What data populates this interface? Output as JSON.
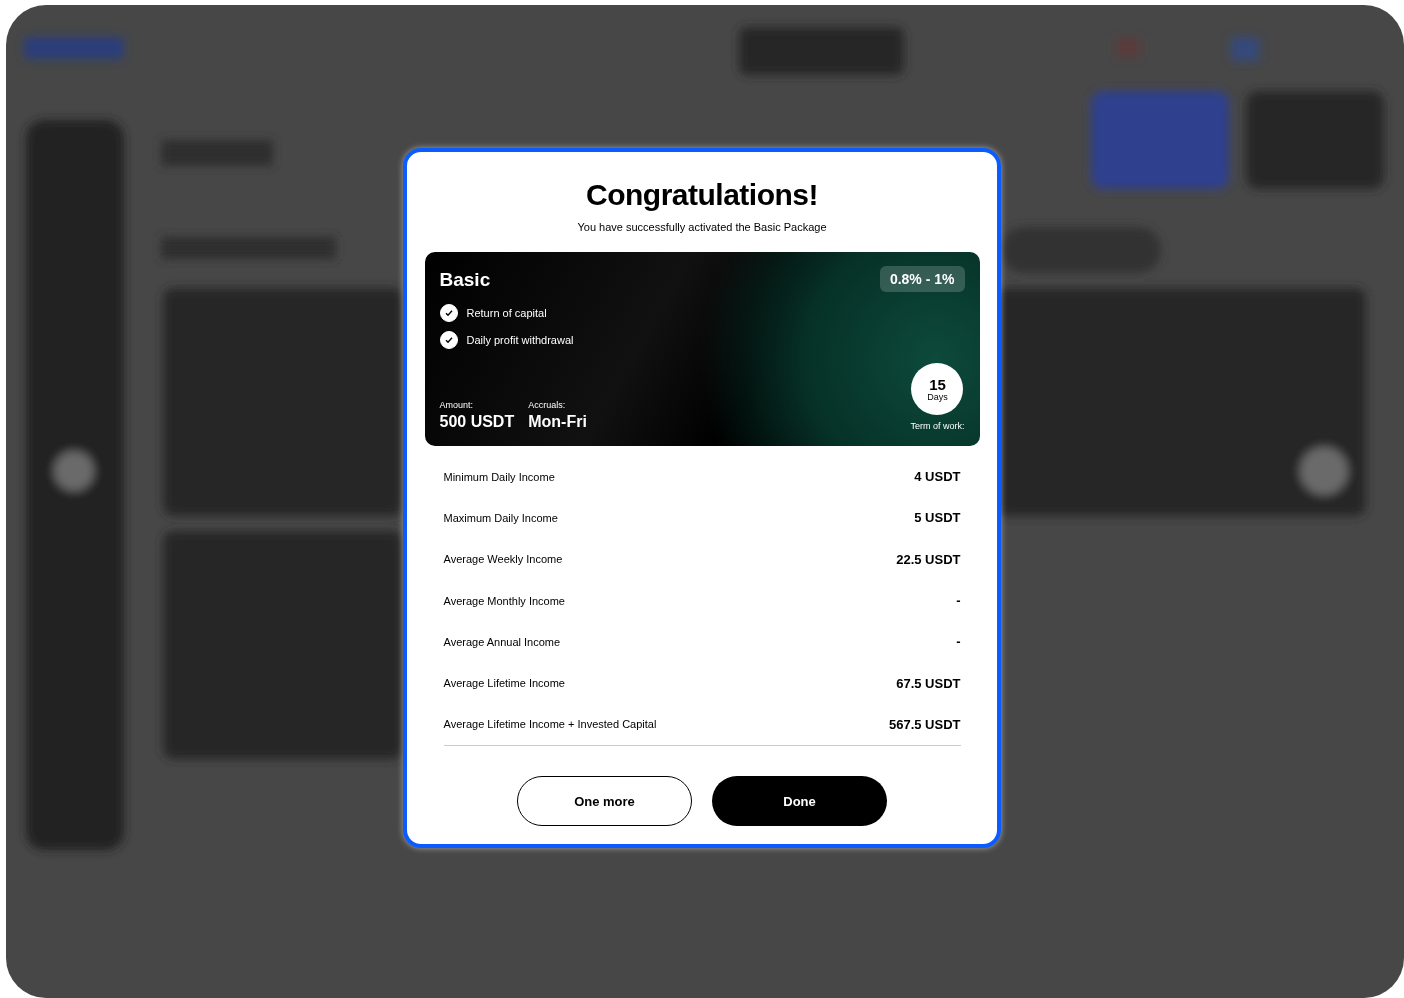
{
  "modal": {
    "title": "Congratulations!",
    "subtitle": "You have successfully activated the Basic Package",
    "package": {
      "name": "Basic",
      "rate": "0.8% - 1%",
      "features": [
        {
          "label": "Return of capital",
          "checked": true
        },
        {
          "label": "Daily profit withdrawal",
          "checked": true
        }
      ],
      "amount_label": "Amount:",
      "amount": "500 USDT",
      "accruals_label": "Accruals:",
      "accruals": "Mon-Fri",
      "term_value": "15",
      "term_unit": "Days",
      "term_label": "Term of work:"
    },
    "stats": [
      {
        "label": "Minimum Daily Income",
        "value": "4 USDT"
      },
      {
        "label": "Maximum Daily Income",
        "value": "5 USDT"
      },
      {
        "label": "Average Weekly Income",
        "value": "22.5 USDT"
      },
      {
        "label": "Average Monthly Income",
        "value": "-"
      },
      {
        "label": "Average Annual Income",
        "value": "-"
      },
      {
        "label": "Average Lifetime Income",
        "value": "67.5 USDT"
      },
      {
        "label": "Average Lifetime Income + Invested Capital",
        "value": "567.5 USDT"
      }
    ],
    "buttons": [
      {
        "label": "One more",
        "kind": "secondary"
      },
      {
        "label": "Done",
        "kind": "primary"
      }
    ]
  }
}
